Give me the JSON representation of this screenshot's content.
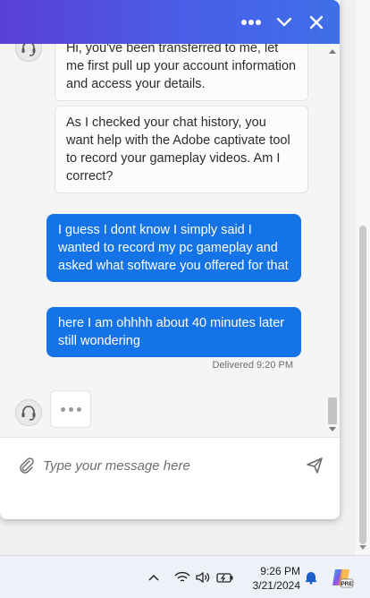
{
  "chat": {
    "messages": {
      "agent_1": "Hi, you've been transferred to me, let me first pull up your account information and access your details.",
      "agent_2": "As I checked your chat history, you want help with the Adobe captivate tool to record your gameplay videos. Am I correct?",
      "user_1": "I guess I dont know I simply said I wanted to record my pc gameplay and asked what software you offered for that",
      "user_2": "here I am ohhhh about 40 minutes later still wondering",
      "delivered": "Delivered 9:20 PM"
    },
    "input": {
      "placeholder": "Type your message here",
      "value": ""
    },
    "header_icons": [
      "more-icon",
      "chevron-down-icon",
      "close-icon"
    ],
    "colors": {
      "header_gradient_start": "#5a3fd6",
      "header_gradient_end": "#3e6fe8",
      "user_bubble": "#1473e6"
    }
  },
  "taskbar": {
    "time": "9:26 PM",
    "date": "3/21/2024",
    "copilot_badge": "PRE",
    "icons": [
      "chevron-up-icon",
      "wifi-icon",
      "speaker-icon",
      "battery-icon",
      "bell-icon",
      "copilot-icon"
    ]
  }
}
